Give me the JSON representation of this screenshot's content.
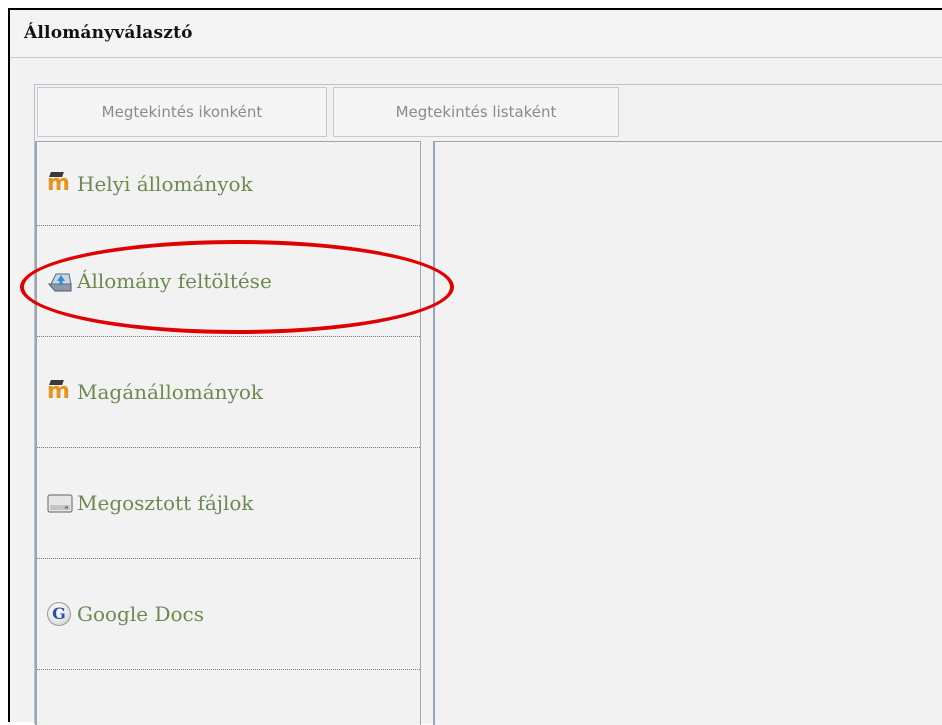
{
  "window": {
    "title": "Állományválasztó"
  },
  "tabs": [
    {
      "label": "Megtekintés ikonként"
    },
    {
      "label": "Megtekintés listaként"
    }
  ],
  "sidebar": {
    "items": [
      {
        "label": "Helyi állományok",
        "icon": "moodle-icon"
      },
      {
        "label": "Állomány feltöltése",
        "icon": "upload-icon",
        "highlighted": true
      },
      {
        "label": "Magánállományok",
        "icon": "moodle-icon"
      },
      {
        "label": "Megosztott fájlok",
        "icon": "drive-icon"
      },
      {
        "label": "Google Docs",
        "icon": "google-icon"
      }
    ]
  },
  "icons": {
    "moodle_glyph": "m",
    "google_glyph": "G"
  },
  "colors": {
    "link_green": "#6c8a4f",
    "highlight_red": "#e00000",
    "moodle_orange": "#e8931c"
  }
}
